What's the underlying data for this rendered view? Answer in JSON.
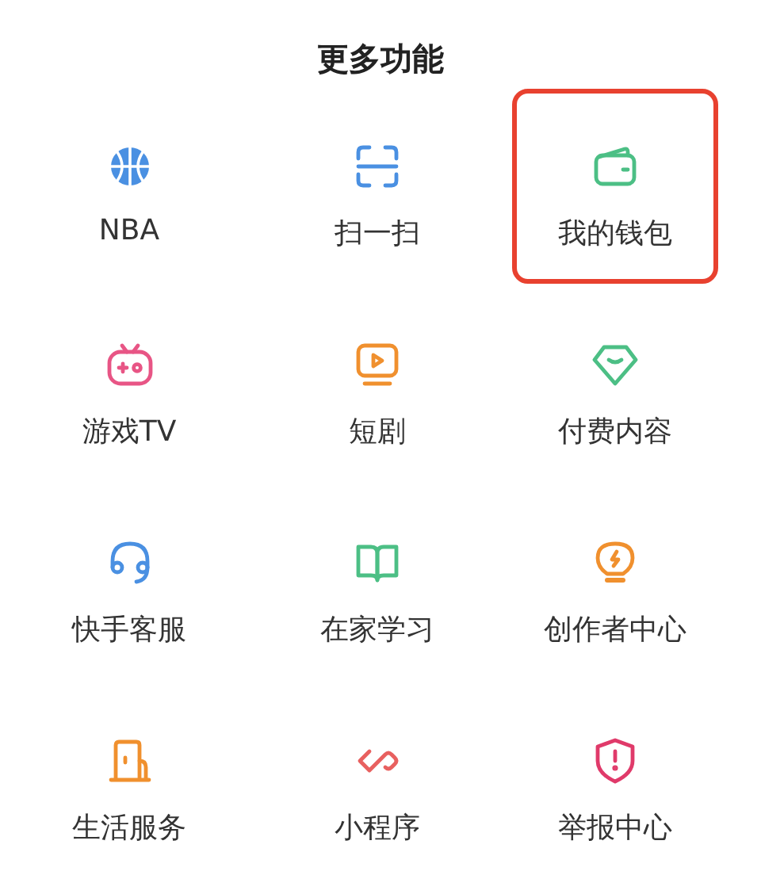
{
  "title": "更多功能",
  "items": [
    {
      "label": "NBA",
      "kind": "basketball",
      "color": "#4a90e2",
      "highlighted": false
    },
    {
      "label": "扫一扫",
      "kind": "scan",
      "color": "#4a90e2",
      "highlighted": false
    },
    {
      "label": "我的钱包",
      "kind": "wallet",
      "color": "#4cbf85",
      "highlighted": true
    },
    {
      "label": "游戏TV",
      "kind": "gametv",
      "color": "#e85585",
      "highlighted": false
    },
    {
      "label": "短剧",
      "kind": "play",
      "color": "#f0902e",
      "highlighted": false
    },
    {
      "label": "付费内容",
      "kind": "diamond",
      "color": "#4cbf85",
      "highlighted": false
    },
    {
      "label": "快手客服",
      "kind": "headset",
      "color": "#4a90e2",
      "highlighted": false
    },
    {
      "label": "在家学习",
      "kind": "book",
      "color": "#4cbf85",
      "highlighted": false
    },
    {
      "label": "创作者中心",
      "kind": "bulb",
      "color": "#f0902e",
      "highlighted": false
    },
    {
      "label": "生活服务",
      "kind": "door",
      "color": "#f0902e",
      "highlighted": false
    },
    {
      "label": "小程序",
      "kind": "loop",
      "color": "#e8605f",
      "highlighted": false
    },
    {
      "label": "举报中心",
      "kind": "shield",
      "color": "#e03a6a",
      "highlighted": false
    }
  ]
}
